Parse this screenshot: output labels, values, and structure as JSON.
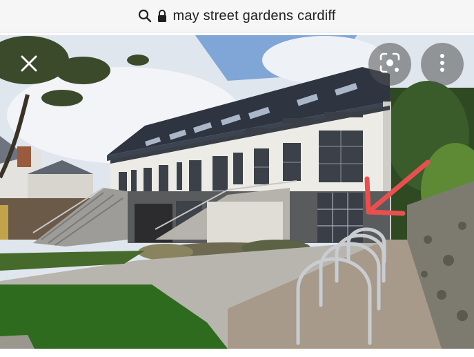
{
  "search": {
    "query": "may street gardens cardiff"
  },
  "icons": {
    "search": "search-icon",
    "lock": "lock-icon",
    "close": "close-icon",
    "lens": "lens-icon",
    "more": "more-vertical-icon",
    "annotation": "arrow-icon"
  },
  "colors": {
    "annotation_arrow": "#e8504f",
    "overlay_button": "#505050"
  }
}
